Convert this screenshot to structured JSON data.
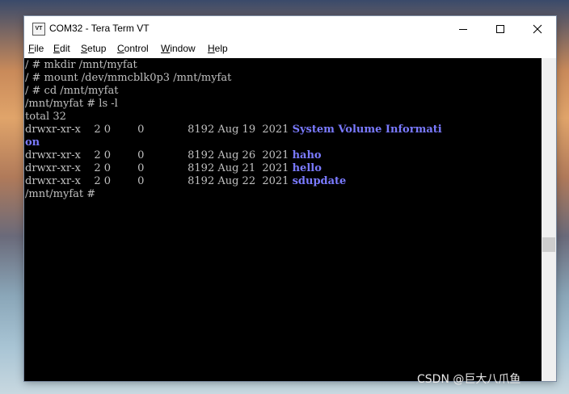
{
  "window": {
    "icon_text": "VT",
    "title": "COM32 - Tera Term VT"
  },
  "menu": [
    {
      "key": "F",
      "rest": "ile"
    },
    {
      "key": "E",
      "rest": "dit"
    },
    {
      "key": "S",
      "rest": "etup"
    },
    {
      "key": "C",
      "rest": "ontrol"
    },
    {
      "key": "W",
      "rest": "indow"
    },
    {
      "key": "H",
      "rest": "elp"
    }
  ],
  "terminal": {
    "lines": [
      "/ # mkdir /mnt/myfat",
      "/ # mount /dev/mmcblk0p3 /mnt/myfat",
      "/ # cd /mnt/myfat",
      "/mnt/myfat # ls -l",
      "total 32"
    ],
    "entries": [
      {
        "meta": "drwxr-xr-x    2 0        0             8192 Aug 19  2021 ",
        "name": "System Volume Informati"
      },
      {
        "wrap": "on"
      },
      {
        "meta": "drwxr-xr-x    2 0        0             8192 Aug 26  2021 ",
        "name": "haho"
      },
      {
        "meta": "drwxr-xr-x    2 0        0             8192 Aug 21  2021 ",
        "name": "hello"
      },
      {
        "meta": "drwxr-xr-x    2 0        0             8192 Aug 22  2021 ",
        "name": "sdupdate"
      }
    ],
    "prompt": "/mnt/myfat # "
  },
  "watermark": "CSDN @巨大八爪鱼",
  "colors": {
    "terminal_bg": "#000000",
    "terminal_fg": "#c0c0c0",
    "directory_name": "#7a7aff"
  }
}
